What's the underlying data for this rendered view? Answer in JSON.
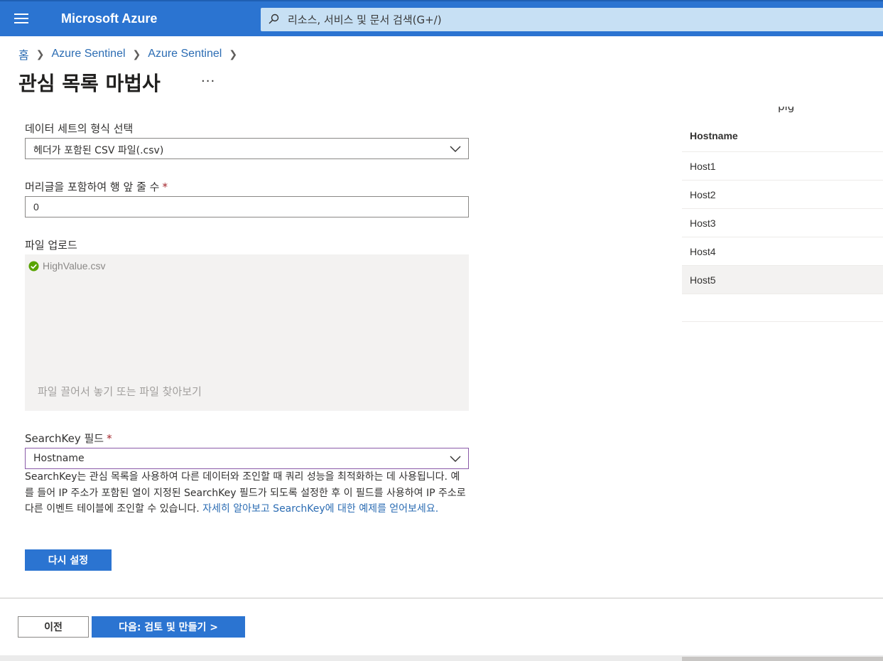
{
  "topbar": {
    "brand": "Microsoft Azure",
    "search_placeholder": "리소스, 서비스 및 문서 검색(G+/)"
  },
  "breadcrumb": {
    "items": [
      "홈",
      "Azure Sentinel",
      "Azure Sentinel"
    ]
  },
  "page": {
    "title": "관심 목록 마법사",
    "more": "···"
  },
  "form": {
    "format": {
      "label": "데이터 세트의 형식 선택",
      "value": "헤더가 포함된 CSV 파일(.csv)"
    },
    "lines": {
      "label": "머리글을 포함하여 행 앞 줄 수",
      "required": "*",
      "value": "0"
    },
    "upload": {
      "label": "파일 업로드",
      "file_name": "HighValue.csv",
      "hint": "파일 끌어서 놓기 또는 파일 찾아보기"
    },
    "searchkey": {
      "label": "SearchKey 필드",
      "required": "*",
      "value": "Hostname",
      "help_text": "SearchKey는 관심 목록을 사용하여 다른 데이터와 조인할 때 쿼리 성능을 최적화하는 데 사용됩니다. 예를 들어 IP 주소가 포함된 열이 지정된 SearchKey 필드가 되도록 설정한 후 이 필드를 사용하여 IP 주소로 다른 이벤트 테이블에 조인할 수 있습니다. ",
      "help_link": "자세히 알아보고 SearchKey에 대한 예제를 얻어보세요."
    },
    "reset_label": "다시 설정"
  },
  "footer": {
    "prev_label": "이전",
    "next_label": "다음: 검토 및 만들기 >"
  },
  "preview": {
    "clipped_title": "pig",
    "column": "Hostname",
    "rows": [
      "Host1",
      "Host2",
      "Host3",
      "Host4",
      "Host5"
    ],
    "selected_row": "Host5"
  },
  "colors": {
    "brand_blue": "#2b74d1",
    "link_blue": "#2b6cb3",
    "required_red": "#a4262c",
    "success_green": "#57a300"
  }
}
